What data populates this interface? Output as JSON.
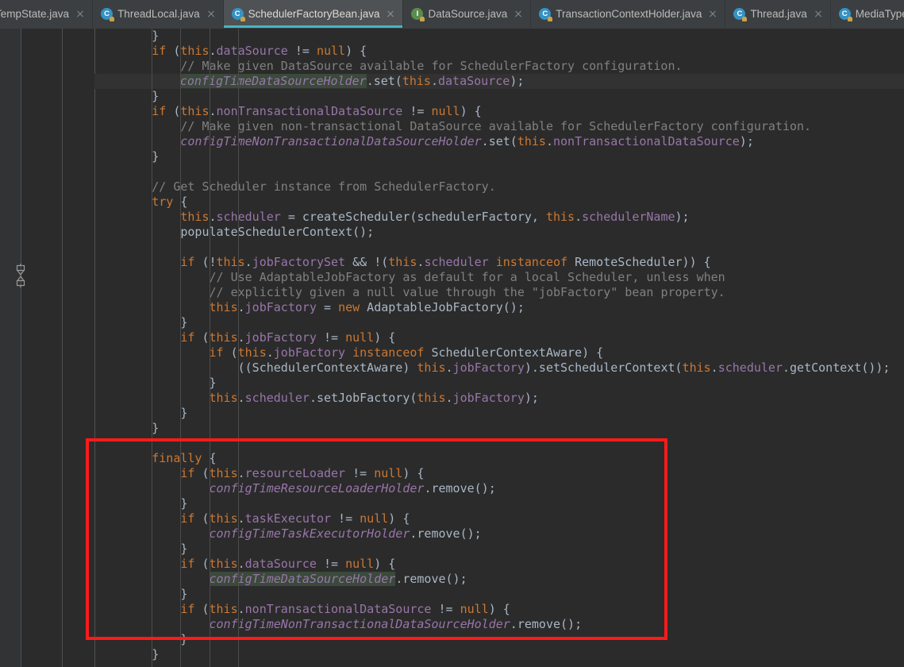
{
  "window": {
    "title": "SchedulerFactoryBean.java",
    "theme_colors": {
      "editor_background": "#2b2b2b",
      "gutter_background": "#313335",
      "tabbar_background": "#3c3f41",
      "active_tab_background": "#4e5254",
      "active_tab_underline": "#46b5c5",
      "caret_line_background": "#323232",
      "keyword": "#cc7832",
      "comment": "#808080",
      "field": "#9876aa",
      "plain_text": "#a9b7c6",
      "string": "#6a8759",
      "occurrence_highlight": "#3b4a3b",
      "annotation_box": "#ff1a1a"
    }
  },
  "tabs": [
    {
      "label": "TempState.java",
      "icon": "java-class-icon",
      "icon_kind": "class",
      "active": false,
      "clipped": true
    },
    {
      "label": "ThreadLocal.java",
      "icon": "java-class-icon",
      "icon_kind": "class",
      "active": false,
      "clipped": false
    },
    {
      "label": "SchedulerFactoryBean.java",
      "icon": "java-class-icon",
      "icon_kind": "class",
      "active": true,
      "clipped": false
    },
    {
      "label": "DataSource.java",
      "icon": "java-interface-icon",
      "icon_kind": "interface",
      "active": false,
      "clipped": false
    },
    {
      "label": "TransactionContextHolder.java",
      "icon": "java-class-icon",
      "icon_kind": "class",
      "active": false,
      "clipped": false
    },
    {
      "label": "Thread.java",
      "icon": "java-class-icon",
      "icon_kind": "class",
      "active": false,
      "clipped": false
    },
    {
      "label": "MediaType.java",
      "icon": "java-class-icon",
      "icon_kind": "class",
      "active": false,
      "clipped": false
    }
  ],
  "gutter": {
    "fold_widget_icon": "collapse-fold-icon"
  },
  "annotation": {
    "shape": "rectangle",
    "color": "#ff1a1a",
    "encloses": "finally block"
  },
  "code": {
    "language": "java",
    "lines": [
      [
        {
          "t": "        }",
          "c": "txt"
        }
      ],
      [
        {
          "t": "        ",
          "c": "txt"
        },
        {
          "t": "if",
          "c": "kw"
        },
        {
          "t": " (",
          "c": "txt"
        },
        {
          "t": "this",
          "c": "kw"
        },
        {
          "t": ".",
          "c": "txt"
        },
        {
          "t": "dataSource",
          "c": "fld"
        },
        {
          "t": " != ",
          "c": "txt"
        },
        {
          "t": "null",
          "c": "kw"
        },
        {
          "t": ") {",
          "c": "txt"
        }
      ],
      [
        {
          "t": "            ",
          "c": "txt"
        },
        {
          "t": "// Make given DataSource available for SchedulerFactory configuration.",
          "c": "cm"
        }
      ],
      [
        {
          "t": "            ",
          "c": "txt"
        },
        {
          "t": "|",
          "c": "caret"
        },
        {
          "t": "configTimeDataSourceHolder",
          "c": "sfld hl"
        },
        {
          "t": ".set(",
          "c": "txt"
        },
        {
          "t": "this",
          "c": "kw"
        },
        {
          "t": ".",
          "c": "txt"
        },
        {
          "t": "dataSource",
          "c": "fld"
        },
        {
          "t": ");",
          "c": "txt"
        }
      ],
      [
        {
          "t": "        }",
          "c": "txt"
        }
      ],
      [
        {
          "t": "        ",
          "c": "txt"
        },
        {
          "t": "if",
          "c": "kw"
        },
        {
          "t": " (",
          "c": "txt"
        },
        {
          "t": "this",
          "c": "kw"
        },
        {
          "t": ".",
          "c": "txt"
        },
        {
          "t": "nonTransactionalDataSource",
          "c": "fld"
        },
        {
          "t": " != ",
          "c": "txt"
        },
        {
          "t": "null",
          "c": "kw"
        },
        {
          "t": ") {",
          "c": "txt"
        }
      ],
      [
        {
          "t": "            ",
          "c": "txt"
        },
        {
          "t": "// Make given non-transactional DataSource available for SchedulerFactory configuration.",
          "c": "cm"
        }
      ],
      [
        {
          "t": "            ",
          "c": "txt"
        },
        {
          "t": "configTimeNonTransactionalDataSourceHolder",
          "c": "sfld"
        },
        {
          "t": ".set(",
          "c": "txt"
        },
        {
          "t": "this",
          "c": "kw"
        },
        {
          "t": ".",
          "c": "txt"
        },
        {
          "t": "nonTransactionalDataSource",
          "c": "fld"
        },
        {
          "t": ");",
          "c": "txt"
        }
      ],
      [
        {
          "t": "        }",
          "c": "txt"
        }
      ],
      [
        {
          "t": "",
          "c": "txt"
        }
      ],
      [
        {
          "t": "        ",
          "c": "txt"
        },
        {
          "t": "// Get Scheduler instance from SchedulerFactory.",
          "c": "cm"
        }
      ],
      [
        {
          "t": "        ",
          "c": "txt"
        },
        {
          "t": "try",
          "c": "kw"
        },
        {
          "t": " {",
          "c": "txt"
        }
      ],
      [
        {
          "t": "            ",
          "c": "txt"
        },
        {
          "t": "this",
          "c": "kw"
        },
        {
          "t": ".",
          "c": "txt"
        },
        {
          "t": "scheduler",
          "c": "fld"
        },
        {
          "t": " = createScheduler(schedulerFactory, ",
          "c": "txt"
        },
        {
          "t": "this",
          "c": "kw"
        },
        {
          "t": ".",
          "c": "txt"
        },
        {
          "t": "schedulerName",
          "c": "fld"
        },
        {
          "t": ");",
          "c": "txt"
        }
      ],
      [
        {
          "t": "            populateSchedulerContext();",
          "c": "txt"
        }
      ],
      [
        {
          "t": "",
          "c": "txt"
        }
      ],
      [
        {
          "t": "            ",
          "c": "txt"
        },
        {
          "t": "if",
          "c": "kw"
        },
        {
          "t": " (!",
          "c": "txt"
        },
        {
          "t": "this",
          "c": "kw"
        },
        {
          "t": ".",
          "c": "txt"
        },
        {
          "t": "jobFactorySet",
          "c": "fld"
        },
        {
          "t": " && !(",
          "c": "txt"
        },
        {
          "t": "this",
          "c": "kw"
        },
        {
          "t": ".",
          "c": "txt"
        },
        {
          "t": "scheduler",
          "c": "fld"
        },
        {
          "t": " ",
          "c": "txt"
        },
        {
          "t": "instanceof",
          "c": "kw"
        },
        {
          "t": " RemoteScheduler)) {",
          "c": "txt"
        }
      ],
      [
        {
          "t": "                ",
          "c": "txt"
        },
        {
          "t": "// Use AdaptableJobFactory as default for a local Scheduler, unless when",
          "c": "cm"
        }
      ],
      [
        {
          "t": "                ",
          "c": "txt"
        },
        {
          "t": "// explicitly given a null value through the \"jobFactory\" bean property.",
          "c": "cm"
        }
      ],
      [
        {
          "t": "                ",
          "c": "txt"
        },
        {
          "t": "this",
          "c": "kw"
        },
        {
          "t": ".",
          "c": "txt"
        },
        {
          "t": "jobFactory",
          "c": "fld"
        },
        {
          "t": " = ",
          "c": "txt"
        },
        {
          "t": "new",
          "c": "kw"
        },
        {
          "t": " AdaptableJobFactory();",
          "c": "txt"
        }
      ],
      [
        {
          "t": "            }",
          "c": "txt"
        }
      ],
      [
        {
          "t": "            ",
          "c": "txt"
        },
        {
          "t": "if",
          "c": "kw"
        },
        {
          "t": " (",
          "c": "txt"
        },
        {
          "t": "this",
          "c": "kw"
        },
        {
          "t": ".",
          "c": "txt"
        },
        {
          "t": "jobFactory",
          "c": "fld"
        },
        {
          "t": " != ",
          "c": "txt"
        },
        {
          "t": "null",
          "c": "kw"
        },
        {
          "t": ") {",
          "c": "txt"
        }
      ],
      [
        {
          "t": "                ",
          "c": "txt"
        },
        {
          "t": "if",
          "c": "kw"
        },
        {
          "t": " (",
          "c": "txt"
        },
        {
          "t": "this",
          "c": "kw"
        },
        {
          "t": ".",
          "c": "txt"
        },
        {
          "t": "jobFactory",
          "c": "fld"
        },
        {
          "t": " ",
          "c": "txt"
        },
        {
          "t": "instanceof",
          "c": "kw"
        },
        {
          "t": " SchedulerContextAware) {",
          "c": "txt"
        }
      ],
      [
        {
          "t": "                    ((SchedulerContextAware) ",
          "c": "txt"
        },
        {
          "t": "this",
          "c": "kw"
        },
        {
          "t": ".",
          "c": "txt"
        },
        {
          "t": "jobFactory",
          "c": "fld"
        },
        {
          "t": ").setSchedulerContext(",
          "c": "txt"
        },
        {
          "t": "this",
          "c": "kw"
        },
        {
          "t": ".",
          "c": "txt"
        },
        {
          "t": "scheduler",
          "c": "fld"
        },
        {
          "t": ".getContext());",
          "c": "txt"
        }
      ],
      [
        {
          "t": "                }",
          "c": "txt"
        }
      ],
      [
        {
          "t": "                ",
          "c": "txt"
        },
        {
          "t": "this",
          "c": "kw"
        },
        {
          "t": ".",
          "c": "txt"
        },
        {
          "t": "scheduler",
          "c": "fld"
        },
        {
          "t": ".setJobFactory(",
          "c": "txt"
        },
        {
          "t": "this",
          "c": "kw"
        },
        {
          "t": ".",
          "c": "txt"
        },
        {
          "t": "jobFactory",
          "c": "fld"
        },
        {
          "t": ");",
          "c": "txt"
        }
      ],
      [
        {
          "t": "            }",
          "c": "txt"
        }
      ],
      [
        {
          "t": "        }",
          "c": "txt"
        }
      ],
      [
        {
          "t": "",
          "c": "txt"
        }
      ],
      [
        {
          "t": "        ",
          "c": "txt"
        },
        {
          "t": "finally",
          "c": "kw"
        },
        {
          "t": " {",
          "c": "txt"
        }
      ],
      [
        {
          "t": "            ",
          "c": "txt"
        },
        {
          "t": "if",
          "c": "kw"
        },
        {
          "t": " (",
          "c": "txt"
        },
        {
          "t": "this",
          "c": "kw"
        },
        {
          "t": ".",
          "c": "txt"
        },
        {
          "t": "resourceLoader",
          "c": "fld"
        },
        {
          "t": " != ",
          "c": "txt"
        },
        {
          "t": "null",
          "c": "kw"
        },
        {
          "t": ") {",
          "c": "txt"
        }
      ],
      [
        {
          "t": "                ",
          "c": "txt"
        },
        {
          "t": "configTimeResourceLoaderHolder",
          "c": "sfld"
        },
        {
          "t": ".remove();",
          "c": "txt"
        }
      ],
      [
        {
          "t": "            }",
          "c": "txt"
        }
      ],
      [
        {
          "t": "            ",
          "c": "txt"
        },
        {
          "t": "if",
          "c": "kw"
        },
        {
          "t": " (",
          "c": "txt"
        },
        {
          "t": "this",
          "c": "kw"
        },
        {
          "t": ".",
          "c": "txt"
        },
        {
          "t": "taskExecutor",
          "c": "fld"
        },
        {
          "t": " != ",
          "c": "txt"
        },
        {
          "t": "null",
          "c": "kw"
        },
        {
          "t": ") {",
          "c": "txt"
        }
      ],
      [
        {
          "t": "                ",
          "c": "txt"
        },
        {
          "t": "configTimeTaskExecutorHolder",
          "c": "sfld"
        },
        {
          "t": ".remove();",
          "c": "txt"
        }
      ],
      [
        {
          "t": "            }",
          "c": "txt"
        }
      ],
      [
        {
          "t": "            ",
          "c": "txt"
        },
        {
          "t": "if",
          "c": "kw"
        },
        {
          "t": " (",
          "c": "txt"
        },
        {
          "t": "this",
          "c": "kw"
        },
        {
          "t": ".",
          "c": "txt"
        },
        {
          "t": "dataSource",
          "c": "fld"
        },
        {
          "t": " != ",
          "c": "txt"
        },
        {
          "t": "null",
          "c": "kw"
        },
        {
          "t": ") {",
          "c": "txt"
        }
      ],
      [
        {
          "t": "                ",
          "c": "txt"
        },
        {
          "t": "configTimeDataSourceHolder",
          "c": "sfld hl"
        },
        {
          "t": ".remove();",
          "c": "txt"
        }
      ],
      [
        {
          "t": "            }",
          "c": "txt"
        }
      ],
      [
        {
          "t": "            ",
          "c": "txt"
        },
        {
          "t": "if",
          "c": "kw"
        },
        {
          "t": " (",
          "c": "txt"
        },
        {
          "t": "this",
          "c": "kw"
        },
        {
          "t": ".",
          "c": "txt"
        },
        {
          "t": "nonTransactionalDataSource",
          "c": "fld"
        },
        {
          "t": " != ",
          "c": "txt"
        },
        {
          "t": "null",
          "c": "kw"
        },
        {
          "t": ") {",
          "c": "txt"
        }
      ],
      [
        {
          "t": "                ",
          "c": "txt"
        },
        {
          "t": "configTimeNonTransactionalDataSourceHolder",
          "c": "sfld"
        },
        {
          "t": ".remove();",
          "c": "txt"
        }
      ],
      [
        {
          "t": "            }",
          "c": "txt"
        }
      ],
      [
        {
          "t": "        }",
          "c": "txt"
        }
      ]
    ],
    "caret_line_index": 3,
    "indent_guide_columns": [
      8,
      12,
      16,
      20
    ]
  }
}
